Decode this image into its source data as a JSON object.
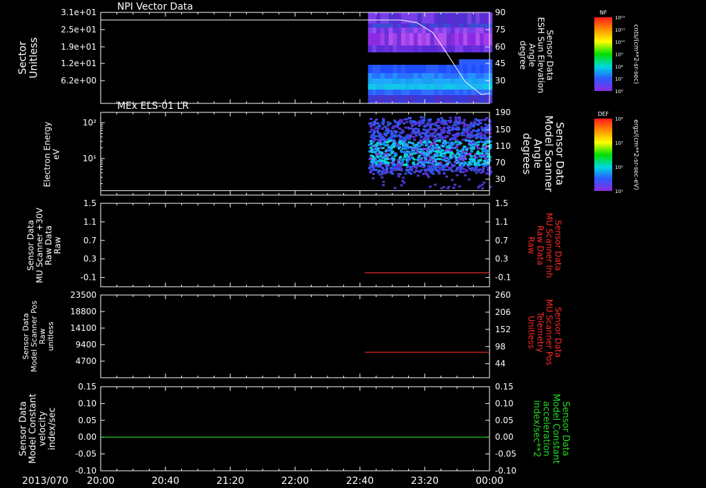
{
  "date_label": "2013/070",
  "x_ticks": [
    "20:00",
    "20:40",
    "21:20",
    "22:00",
    "22:40",
    "23:20",
    "00:00"
  ],
  "colors": {
    "background": "#000000",
    "axes": "#ffffff",
    "red_trace": "#ff2a2a",
    "green_trace": "#22dd22"
  },
  "chart_data": [
    {
      "type": "heatmap",
      "title": "NPI Vector Data",
      "ylabel_left": [
        "Sector",
        "Unitless"
      ],
      "yticks_left": [
        "3.1e+01",
        "2.5e+01",
        "1.9e+01",
        "1.2e+01",
        "6.2e+00"
      ],
      "ylabel_right": [
        "Sensor Data",
        "ESH Sun Elevation",
        "Angle",
        "degree"
      ],
      "yticks_right": [
        "90",
        "75",
        "60",
        "45",
        "30"
      ],
      "ylim_right": [
        18,
        90
      ],
      "line_series": {
        "name": "ESH Sun Elevation Angle",
        "x": [
          "20:00",
          "23:05",
          "23:15",
          "23:25",
          "23:35",
          "23:45",
          "23:55",
          "00:00"
        ],
        "y": [
          84,
          84,
          82,
          74,
          55,
          35,
          25,
          26
        ]
      },
      "data_start": "22:45",
      "colorbar": {
        "label": "NF",
        "units": "cnts/(cm**2-sr-sec)",
        "ticks": [
          "10¹²",
          "10¹¹",
          "10¹⁰",
          "10⁹",
          "10⁸",
          "10⁷",
          "10⁶"
        ]
      }
    },
    {
      "type": "heatmap",
      "title": "MEx ELS-01 LR",
      "ylabel_left": [
        "Electron Energy",
        "eV"
      ],
      "yticks_left": [
        "10²",
        "10¹"
      ],
      "yscale": "log",
      "ylabel_right": [
        "Sensor Data",
        "Model Scanner",
        "Angle",
        "degrees"
      ],
      "yticks_right": [
        "190",
        "150",
        "110",
        "70",
        "30"
      ],
      "ylim_right": [
        0,
        190
      ],
      "line_series": {
        "name": "Model Scanner Angle",
        "x": [
          "20:00",
          "00:00"
        ],
        "y": [
          10,
          10
        ]
      },
      "data_start": "22:45",
      "colorbar": {
        "label": "DEF",
        "units": "ergs/(cm**2-sr-sec-eV)",
        "ticks": [
          "10⁴",
          "10³",
          "10²",
          "10¹"
        ]
      }
    },
    {
      "type": "line",
      "ylabel_left": [
        "Sensor Data",
        "MU Scanner +30V",
        "Raw Data",
        "Raw"
      ],
      "yticks_left": [
        "1.5",
        "1.1",
        "0.7",
        "0.3",
        "-0.1"
      ],
      "ylim": [
        -0.3,
        1.5
      ],
      "ylabel_right": [
        "Sensor Data",
        "MU Scanner Inh",
        "Raw Data",
        "Raw"
      ],
      "yticks_right": [
        "1.5",
        "1.1",
        "0.7",
        "0.3",
        "-0.1"
      ],
      "series": [
        {
          "x": [
            "22:43",
            "00:00"
          ],
          "y": [
            0.0,
            0.0
          ],
          "color": "#ff2a2a"
        }
      ]
    },
    {
      "type": "line",
      "ylabel_left": [
        "Sensor Data",
        "Model Scanner Pos",
        "Raw",
        "unitless"
      ],
      "yticks_left": [
        "23500",
        "18800",
        "14100",
        "9400",
        "4700"
      ],
      "ylim_left": [
        0,
        23500
      ],
      "ylabel_right": [
        "Sensor Data",
        "MU Scanner Pos",
        "Telemetry",
        "Unitless"
      ],
      "yticks_right": [
        "260",
        "206",
        "152",
        "98",
        "44"
      ],
      "ylim": [
        0,
        260
      ],
      "series": [
        {
          "x": [
            "22:43",
            "00:00"
          ],
          "y": [
            80,
            80
          ],
          "color": "#ff2a2a"
        }
      ]
    },
    {
      "type": "line",
      "ylabel_left": [
        "Sensor Data",
        "Model Constant",
        "velocity",
        "index/sec"
      ],
      "yticks_left": [
        "0.15",
        "0.10",
        "0.05",
        "0.00",
        "-0.05",
        "-0.10"
      ],
      "ylim": [
        -0.1,
        0.15
      ],
      "ylabel_right": [
        "Sensor Data",
        "Model Constant",
        "acceleration",
        "index/sec**2"
      ],
      "yticks_right": [
        "0.15",
        "0.10",
        "0.05",
        "0.00",
        "-0.05",
        "-0.10"
      ],
      "series": [
        {
          "x": [
            "20:00",
            "00:00"
          ],
          "y": [
            0.0,
            0.0
          ],
          "color": "#22dd22"
        }
      ]
    }
  ]
}
